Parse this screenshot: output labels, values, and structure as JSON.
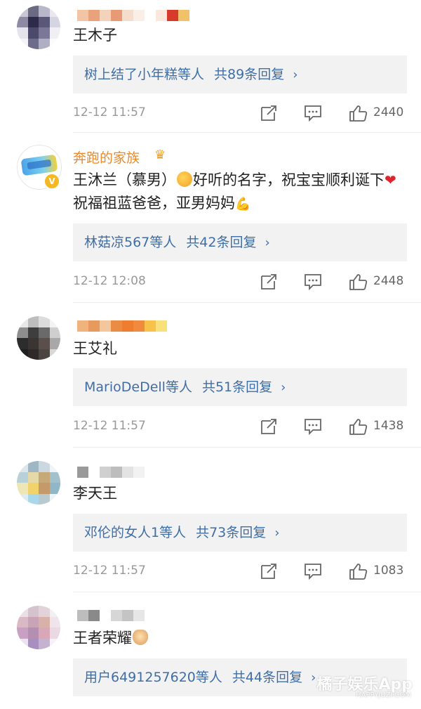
{
  "colors": {
    "username": "#e98a2c",
    "reply_link": "#3f6ea7",
    "meta_text": "#999999",
    "reply_bg": "#f2f2f2"
  },
  "comments": [
    {
      "username": "",
      "text": "王木子",
      "reply": {
        "who": "树上结了小年糕等人",
        "count": "共89条回复",
        "chevron": "›"
      },
      "time": "12-12 11:57",
      "likes": "2440"
    },
    {
      "username": "奔跑的家族",
      "text_parts": [
        "王沐兰（慕男）",
        "好听的名字，祝宝宝顺利诞下",
        "祝福祖蓝爸爸，亚男妈妈"
      ],
      "reply": {
        "who": "林菇凉567等人",
        "count": "共42条回复",
        "chevron": "›"
      },
      "time": "12-12 12:08",
      "likes": "2448"
    },
    {
      "username": "",
      "text": "王艾礼",
      "reply": {
        "who": "MarioDeDell等人",
        "count": "共51条回复",
        "chevron": "›"
      },
      "time": "12-12 11:57",
      "likes": "1438"
    },
    {
      "username": "",
      "text": "李天王",
      "reply": {
        "who": "邓伦的女人1等人",
        "count": "共73条回复",
        "chevron": "›"
      },
      "time": "12-12 11:57",
      "likes": "1083"
    },
    {
      "username": "",
      "text": "王者荣耀",
      "reply": {
        "who": "用户6491257620等人",
        "count": "共44条回复",
        "chevron": "›"
      },
      "time": "",
      "likes": ""
    }
  ],
  "icons": {
    "repost": "repost-icon",
    "comment": "comment-icon",
    "like": "thumbs-up-icon",
    "verified": "verified-badge-icon",
    "crown": "crown-icon"
  },
  "watermark": {
    "main": "橘子娱乐App",
    "sub": "HAPPYJUZI.COM"
  }
}
